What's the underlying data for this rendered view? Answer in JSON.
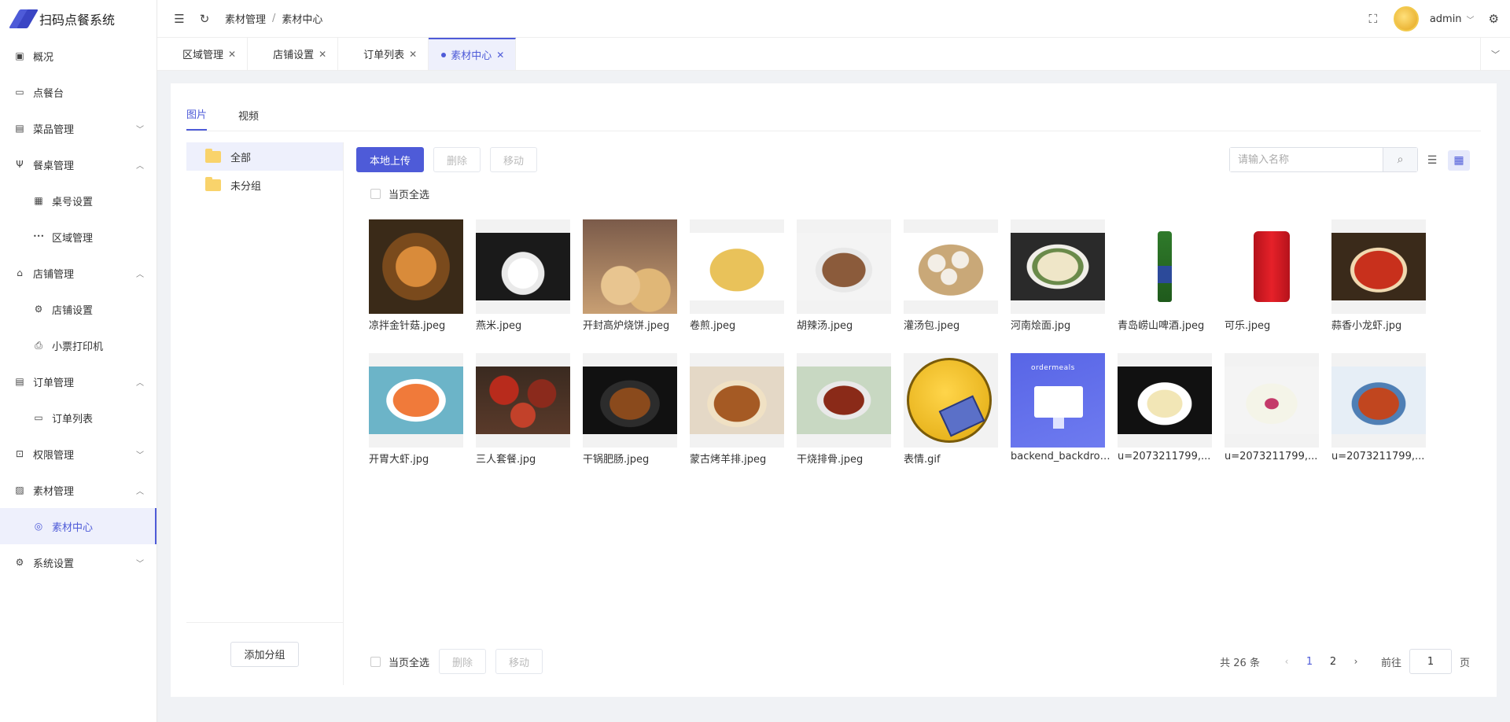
{
  "app": {
    "title": "扫码点餐系统",
    "accent_color": "#4e5bd8"
  },
  "sidebar": {
    "items": [
      {
        "label": "概况",
        "icon": "dashboard-icon",
        "level": 0,
        "chevron": ""
      },
      {
        "label": "点餐台",
        "icon": "monitor-icon",
        "level": 0,
        "chevron": ""
      },
      {
        "label": "菜品管理",
        "icon": "dish-icon",
        "level": 0,
        "chevron": "﹀"
      },
      {
        "label": "餐桌管理",
        "icon": "fork-knife-icon",
        "level": 0,
        "chevron": "︿"
      },
      {
        "label": "桌号设置",
        "icon": "table-number-icon",
        "level": 1,
        "chevron": ""
      },
      {
        "label": "区域管理",
        "icon": "more-dots-icon",
        "level": 1,
        "chevron": ""
      },
      {
        "label": "店铺管理",
        "icon": "shop-icon",
        "level": 0,
        "chevron": "︿"
      },
      {
        "label": "店铺设置",
        "icon": "gear-icon",
        "level": 1,
        "chevron": ""
      },
      {
        "label": "小票打印机",
        "icon": "printer-icon",
        "level": 1,
        "chevron": ""
      },
      {
        "label": "订单管理",
        "icon": "document-icon",
        "level": 0,
        "chevron": "︿"
      },
      {
        "label": "订单列表",
        "icon": "list-card-icon",
        "level": 1,
        "chevron": ""
      },
      {
        "label": "权限管理",
        "icon": "lock-icon",
        "level": 0,
        "chevron": "﹀"
      },
      {
        "label": "素材管理",
        "icon": "image-icon",
        "level": 0,
        "chevron": "︿"
      },
      {
        "label": "素材中心",
        "icon": "gallery-icon",
        "level": 1,
        "chevron": "",
        "active": true
      },
      {
        "label": "系统设置",
        "icon": "settings-icon",
        "level": 0,
        "chevron": "﹀"
      }
    ]
  },
  "header": {
    "breadcrumb": [
      "素材管理",
      "素材中心"
    ],
    "breadcrumb_sep": "/",
    "user_name": "admin"
  },
  "tabs": [
    {
      "label": "区域管理",
      "active": false
    },
    {
      "label": "店铺设置",
      "active": false
    },
    {
      "label": "订单列表",
      "active": false
    },
    {
      "label": "素材中心",
      "active": true
    }
  ],
  "sub_tabs": [
    {
      "label": "图片",
      "active": true
    },
    {
      "label": "视频",
      "active": false
    }
  ],
  "groups": {
    "items": [
      {
        "label": "全部",
        "active": true
      },
      {
        "label": "未分组",
        "active": false
      }
    ],
    "add_label": "添加分组"
  },
  "toolbar": {
    "upload_label": "本地上传",
    "delete_label": "删除",
    "move_label": "移动",
    "search_placeholder": "请输入名称",
    "select_all_label": "当页全选"
  },
  "files": [
    {
      "name": "凉拌金针菇.jpeg",
      "art": "food-noodles"
    },
    {
      "name": "燕米.jpeg",
      "art": "rice"
    },
    {
      "name": "开封高炉烧饼.jpeg",
      "art": "bread"
    },
    {
      "name": "卷煎.jpeg",
      "art": "crepe"
    },
    {
      "name": "胡辣汤.jpeg",
      "art": "soup"
    },
    {
      "name": "灌汤包.jpeg",
      "art": "dumplings"
    },
    {
      "name": "河南烩面.jpg",
      "art": "noodle-soup"
    },
    {
      "name": "青岛崂山啤酒.jpeg",
      "art": "beer"
    },
    {
      "name": "可乐.jpeg",
      "art": "cola"
    },
    {
      "name": "蒜香小龙虾.jpg",
      "art": "crayfish"
    },
    {
      "name": "开胃大虾.jpg",
      "art": "shrimp"
    },
    {
      "name": "三人套餐.jpg",
      "art": "set-meal"
    },
    {
      "name": "干锅肥肠.jpeg",
      "art": "dry-pot"
    },
    {
      "name": "蒙古烤羊排.jpeg",
      "art": "lamb"
    },
    {
      "name": "干烧排骨.jpeg",
      "art": "ribs"
    },
    {
      "name": "表情.gif",
      "art": "emoji"
    },
    {
      "name": "backend_backdrop.png",
      "art": "ordermeals"
    },
    {
      "name": "u=2073211799,...",
      "art": "plate-white"
    },
    {
      "name": "u=2073211799,...",
      "art": "rolls"
    },
    {
      "name": "u=2073211799,...",
      "art": "stew"
    }
  ],
  "ordermeals_text": "ordermeals",
  "pagination": {
    "total_label": "共 26 条",
    "pages": [
      "1",
      "2"
    ],
    "current": "1",
    "goto_label": "前往",
    "goto_value": "1",
    "page_unit": "页"
  }
}
